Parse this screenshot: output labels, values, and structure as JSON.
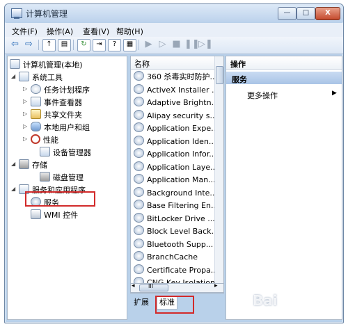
{
  "window": {
    "title": "计算机管理"
  },
  "controls": {
    "minimize": "—",
    "maximize": "□",
    "close": "X"
  },
  "menu": [
    "文件(F)",
    "操作(A)",
    "查看(V)",
    "帮助(H)"
  ],
  "toolbar": {
    "back": "⇦",
    "forward": "⇨"
  },
  "tree": {
    "root": "计算机管理(本地)",
    "system_tools": "系统工具",
    "task_scheduler": "任务计划程序",
    "event_viewer": "事件查看器",
    "shared_folders": "共享文件夹",
    "local_users": "本地用户和组",
    "performance": "性能",
    "device_manager": "设备管理器",
    "storage": "存储",
    "disk_management": "磁盘管理",
    "services_apps": "服务和应用程序",
    "services": "服务",
    "wmi": "WMI 控件"
  },
  "list": {
    "header": "名称",
    "items": [
      "360 杀毒实时防护...",
      "ActiveX Installer ...",
      "Adaptive Brightn...",
      "Alipay security s...",
      "Application Expe...",
      "Application Iden...",
      "Application Infor...",
      "Application Laye...",
      "Application Man...",
      "Background Inte...",
      "Base Filtering En...",
      "BitLocker Drive ...",
      "Block Level Back...",
      "Bluetooth Supp...",
      "BranchCache",
      "Certificate Propa...",
      "CNG Key Isolation"
    ],
    "hscroll_thumb": "III"
  },
  "tabs": {
    "extended": "扩展",
    "standard": "标准"
  },
  "actions": {
    "header": "操作",
    "section": "服务",
    "more": "更多操作"
  },
  "watermark": "Bai"
}
